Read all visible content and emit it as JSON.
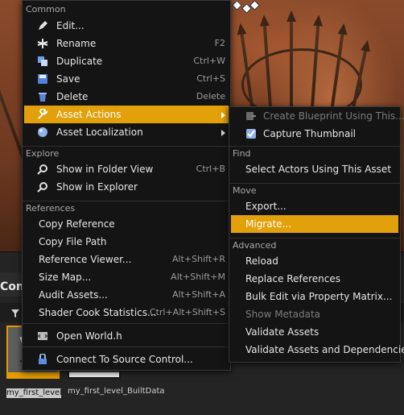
{
  "main_menu": {
    "sections": {
      "common": "Common",
      "explore": "Explore",
      "references": "References"
    },
    "items": {
      "edit": "Edit...",
      "rename": "Rename",
      "rename_sc": "F2",
      "duplicate": "Duplicate",
      "duplicate_sc": "Ctrl+W",
      "save": "Save",
      "save_sc": "Ctrl+S",
      "delete": "Delete",
      "delete_sc": "Delete",
      "asset_actions": "Asset Actions",
      "asset_localization": "Asset Localization",
      "show_in_folder": "Show in Folder View",
      "show_in_folder_sc": "Ctrl+B",
      "show_in_explorer": "Show in Explorer",
      "copy_reference": "Copy Reference",
      "copy_file_path": "Copy File Path",
      "reference_viewer": "Reference Viewer...",
      "reference_viewer_sc": "Alt+Shift+R",
      "size_map": "Size Map...",
      "size_map_sc": "Alt+Shift+M",
      "audit_assets": "Audit Assets...",
      "audit_assets_sc": "Alt+Shift+A",
      "shader_cook": "Shader Cook Statistics...",
      "shader_cook_sc": "Ctrl+Alt+Shift+S",
      "open_world": "Open World.h",
      "connect_source": "Connect To Source Control..."
    }
  },
  "sub_menu": {
    "sections": {
      "find": "Find",
      "move": "Move",
      "advanced": "Advanced"
    },
    "items": {
      "create_blueprint": "Create Blueprint Using This...",
      "capture_thumbnail": "Capture Thumbnail",
      "select_actors": "Select Actors Using This Asset",
      "export": "Export...",
      "migrate": "Migrate...",
      "reload": "Reload",
      "replace_references": "Replace References",
      "bulk_edit": "Bulk Edit via Property Matrix...",
      "show_metadata": "Show Metadata",
      "validate_assets": "Validate Assets",
      "validate_deps": "Validate Assets and Dependencies"
    }
  },
  "content_browser": {
    "tab_label": "Conte",
    "assets": [
      {
        "name": "my_first_level"
      },
      {
        "name": "my_first_level_BuiltData"
      }
    ]
  },
  "colors": {
    "highlight": "#e2a00b",
    "menu_bg": "#141414",
    "selection_border": "#e59c00"
  }
}
